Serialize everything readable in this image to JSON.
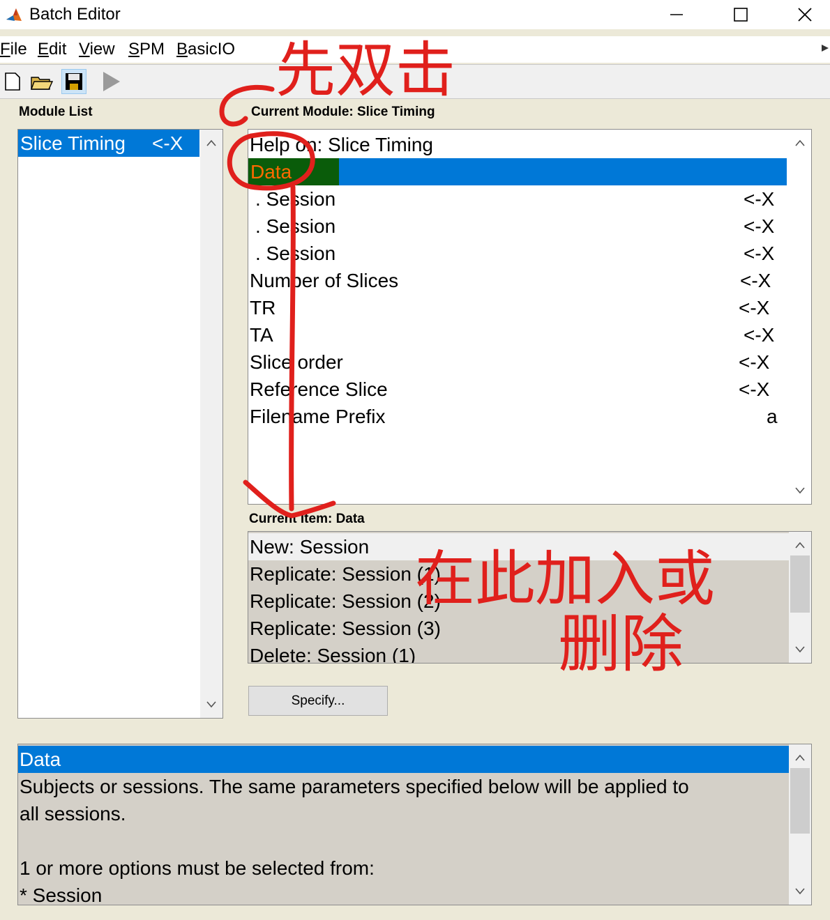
{
  "window": {
    "title": "Batch Editor",
    "controls": {
      "minimize": "—",
      "maximize": "☐",
      "close": "✕"
    }
  },
  "menu": {
    "items": [
      {
        "key": "F",
        "rest": "ile"
      },
      {
        "key": "E",
        "rest": "dit"
      },
      {
        "key": "V",
        "rest": "iew"
      },
      {
        "key": "S",
        "rest": "PM"
      },
      {
        "key": "B",
        "rest": "asicIO"
      }
    ]
  },
  "toolbar": {
    "icons": [
      "new-file-icon",
      "open-folder-icon",
      "save-disk-icon",
      "run-play-icon"
    ]
  },
  "module_list": {
    "label": "Module List",
    "items": [
      {
        "name": "Slice Timing",
        "status": "<-X",
        "selected": true
      }
    ]
  },
  "current_module": {
    "label": "Current Module: Slice Timing",
    "items": [
      {
        "label": "Help on: Slice Timing",
        "value": ""
      },
      {
        "label": "Data",
        "value": "",
        "selected": true
      },
      {
        "label": ". Session",
        "value": "<-X"
      },
      {
        "label": ". Session",
        "value": "<-X"
      },
      {
        "label": ". Session",
        "value": "<-X"
      },
      {
        "label": "Number of Slices",
        "value": "<-X"
      },
      {
        "label": "TR",
        "value": "<-X"
      },
      {
        "label": "TA",
        "value": "<-X"
      },
      {
        "label": "Slice order",
        "value": "<-X"
      },
      {
        "label": "Reference Slice",
        "value": "<-X"
      },
      {
        "label": "Filename Prefix",
        "value": "a"
      }
    ]
  },
  "current_item": {
    "label": "Current Item: Data",
    "items": [
      "New: Session",
      "Replicate: Session (1)",
      "Replicate: Session (2)",
      "Replicate: Session (3)",
      "Delete: Session (1)"
    ]
  },
  "specify_button": {
    "label": "Specify..."
  },
  "help_panel": {
    "title": "Data",
    "lines": [
      "Subjects or sessions. The same parameters specified below will be applied to",
      "all sessions.",
      "",
      "1 or more options must be selected from:",
      "* Session"
    ]
  },
  "annotations": {
    "top_note": "先双击",
    "bottom_note_line1": "在此加入或",
    "bottom_note_line2": "删除",
    "ink_color": "#e0201c"
  },
  "colors": {
    "selection": "#0078d7",
    "data_highlight": "#0a5c0a",
    "data_text": "#ff6a00",
    "background": "#ece9d8"
  }
}
